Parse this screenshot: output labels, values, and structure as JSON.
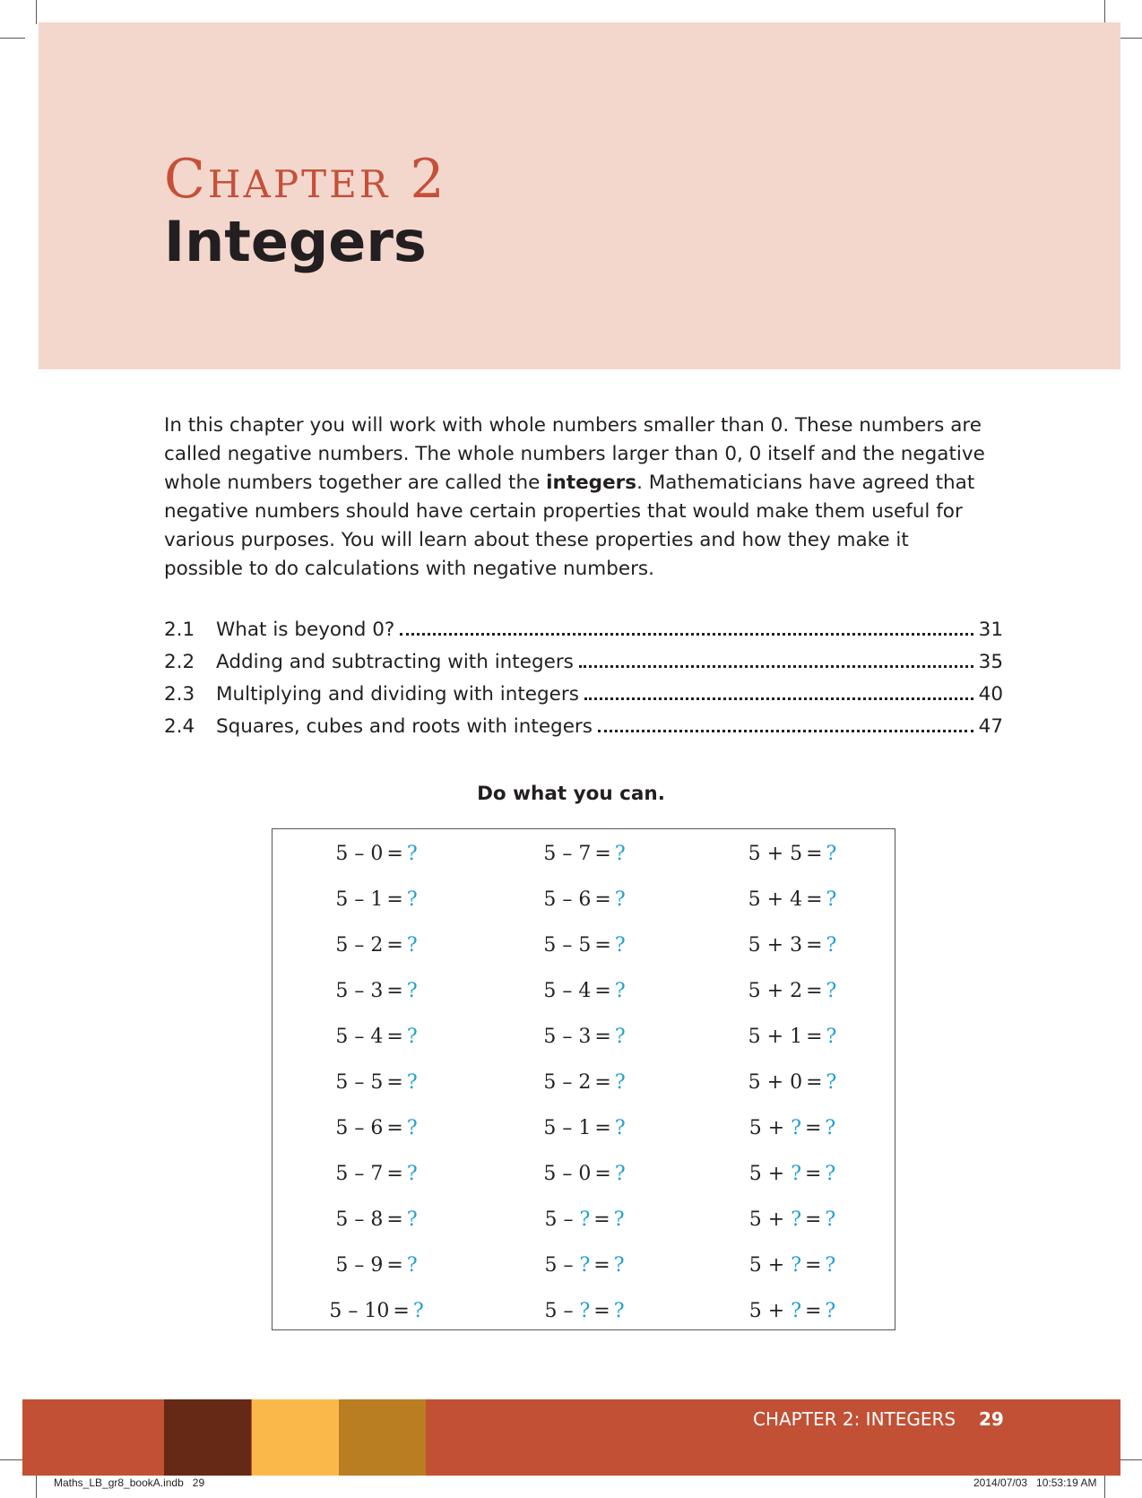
{
  "header": {
    "chapter_label": "Chapter 2",
    "title": "Integers"
  },
  "intro": {
    "before_bold": "In this chapter you will work with whole numbers smaller than 0. These numbers are called negative numbers. The whole numbers larger than 0, 0 itself and the negative whole numbers together are called the ",
    "bold": "integers",
    "after_bold": ". Mathematicians have agreed that negative numbers should have certain properties that would make them useful for various purposes. You will learn about these properties and how they make it possible to do calculations with negative numbers."
  },
  "toc": [
    {
      "number": "2.1",
      "title": "What is beyond 0?",
      "page": "31"
    },
    {
      "number": "2.2",
      "title": "Adding and subtracting with integers",
      "page": "35"
    },
    {
      "number": "2.3",
      "title": "Multiplying and dividing with integers",
      "page": "40"
    },
    {
      "number": "2.4",
      "title": "Squares, cubes and roots with integers",
      "page": "47"
    }
  ],
  "prompt": "Do what you can.",
  "answer_mark": "?",
  "equals_sign": "=",
  "exercises": {
    "column_1": [
      "5 – 0",
      "5 – 1",
      "5 – 2",
      "5 – 3",
      "5 – 4",
      "5 – 5",
      "5 – 6",
      "5 – 7",
      "5 – 8",
      "5 – 9",
      "5 – 10"
    ],
    "column_2": [
      "5 – 7",
      "5 – 6",
      "5 – 5",
      "5 – 4",
      "5 – 3",
      "5 – 2",
      "5 – 1",
      "5 – 0",
      "5 – ?",
      "5 – ?",
      "5 – ?"
    ],
    "column_3": [
      "5 + 5",
      "5 + 4",
      "5 + 3",
      "5 + 2",
      "5 + 1",
      "5 + 0",
      "5 + ?",
      "5 + ?",
      "5 + ?",
      "5 + ?",
      "5 + ?"
    ]
  },
  "footer": {
    "chapter_text": "CHAPTER 2: INTEGERS",
    "page_number": "29",
    "file_slug": "Maths_LB_gr8_bookA.indb   29",
    "date_slug": "2014/07/03   10:53:19 AM"
  },
  "colors": {
    "header_band": "#f3d7cd",
    "chapter_label": "#c5503a",
    "answer_mark": "#1d9fd6",
    "footer_band": "#c25035",
    "swatch_1": "#662916",
    "swatch_2": "#fbb84a",
    "swatch_3": "#b97e22"
  }
}
